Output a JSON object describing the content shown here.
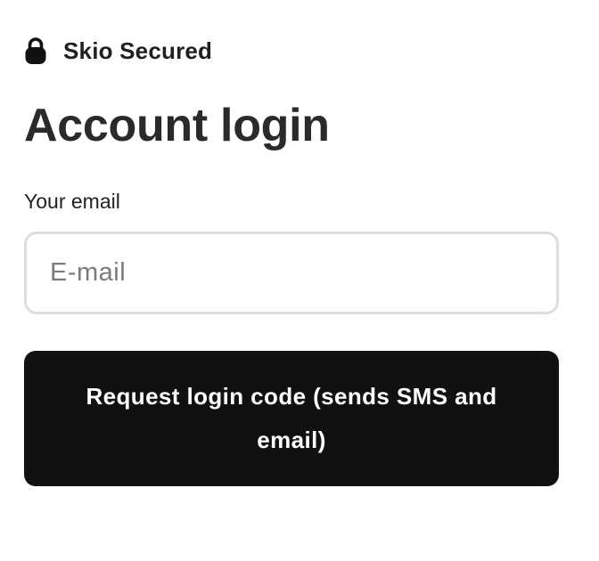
{
  "header": {
    "badge_icon": "lock-icon",
    "badge_text": "Skio Secured"
  },
  "main": {
    "title": "Account login",
    "email_label": "Your email",
    "email_value": "",
    "email_placeholder": "E-mail",
    "submit_label": "Request login code (sends SMS and email)"
  },
  "colors": {
    "button_background": "#111111",
    "button_text": "#ffffff",
    "input_border": "#dddddd",
    "placeholder": "#7b7b7b",
    "text": "#222222"
  }
}
